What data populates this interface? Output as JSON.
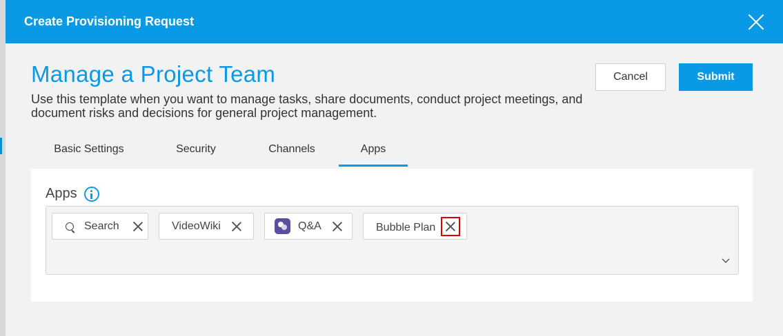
{
  "modal": {
    "title": "Create Provisioning Request",
    "close_icon": "close-icon"
  },
  "page": {
    "title": "Manage a Project Team",
    "description": "Use this template when you want to manage tasks, share documents, conduct project meetings, and document risks and decisions for general project management."
  },
  "actions": {
    "cancel_label": "Cancel",
    "submit_label": "Submit"
  },
  "tabs": [
    {
      "label": "Basic Settings",
      "active": false
    },
    {
      "label": "Security",
      "active": false
    },
    {
      "label": "Channels",
      "active": false
    },
    {
      "label": "Apps",
      "active": true
    }
  ],
  "apps_section": {
    "label": "Apps",
    "info_icon": "info-icon",
    "chips": [
      {
        "label": "Search",
        "icon": "search-icon"
      },
      {
        "label": "VideoWiki",
        "icon": ""
      },
      {
        "label": "Q&A",
        "icon": "qa-app-icon"
      },
      {
        "label": "Bubble Plan",
        "icon": ""
      }
    ],
    "dropdown_icon": "chevron-down-icon"
  },
  "colors": {
    "accent": "#0a9ae5",
    "highlight_box": "#e00000",
    "qa_icon_bg": "#5b4e9c"
  }
}
